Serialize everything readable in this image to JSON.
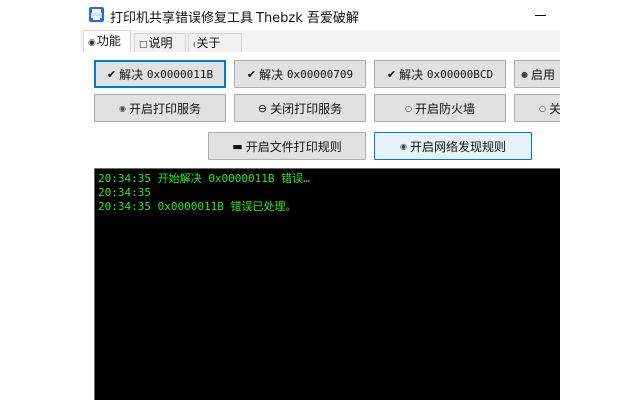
{
  "window": {
    "title": "打印机共享错误修复工具",
    "author": "Thebzk 吾爱破解",
    "minimize_label": "—"
  },
  "tabs": [
    {
      "icon": "◉",
      "label": "功能",
      "active": true
    },
    {
      "icon": "□",
      "label": "说明",
      "active": false
    },
    {
      "icon": "ı",
      "label": "关于",
      "active": false
    }
  ],
  "buttons": {
    "fix_11b": {
      "icon": "✔",
      "prefix": "解决",
      "code": "0x0000011B"
    },
    "fix_709": {
      "icon": "✔",
      "prefix": "解决",
      "code": "0x00000709"
    },
    "fix_bcd": {
      "icon": "✔",
      "prefix": "解决",
      "code": "0x00000BCD"
    },
    "enable_cut": {
      "icon": "●",
      "label": "启用"
    },
    "start_spooler": {
      "icon": "◉",
      "label": "开启打印服务"
    },
    "stop_spooler": {
      "icon": "⊖",
      "label": "关闭打印服务"
    },
    "start_firewall": {
      "icon": "○",
      "label": "开启防火墙"
    },
    "close_cut": {
      "icon": "○",
      "label": "关"
    },
    "file_print_rules": {
      "icon": "▬",
      "label": "开启文件打印规则"
    },
    "network_discovery_rules": {
      "icon": "◉",
      "label": "开启网络发现规则"
    }
  },
  "log": [
    "20:34:35 开始解决 0x0000011B 错误…",
    "20:34:35",
    "20:34:35 0x0000011B 错误已处理。"
  ],
  "colors": {
    "log_text": "#27e827",
    "console_bg": "#000000",
    "accent": "#0078d7",
    "icon_blue": "#2a6dd9"
  }
}
